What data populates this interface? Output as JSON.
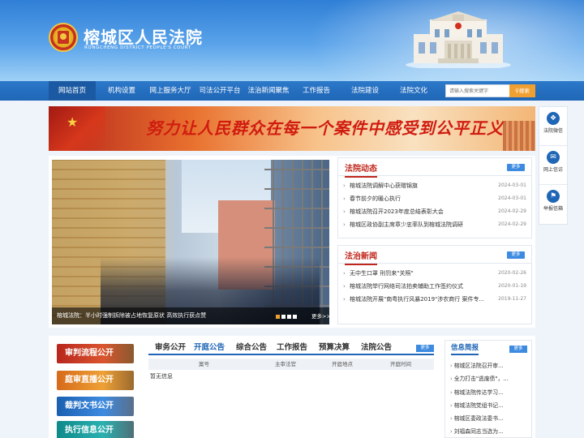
{
  "header": {
    "title": "榕城区人民法院",
    "subtitle": "RONGCHENG DISTRICT PEOPLE'S COURT"
  },
  "nav": {
    "items": [
      "网站首页",
      "机构设置",
      "网上服务大厅",
      "司法公开平台",
      "法治新闻聚焦",
      "工作报告",
      "法院建设",
      "法院文化"
    ],
    "search_placeholder": "请输入搜索关键字",
    "search_button": "搜索"
  },
  "banner": {
    "slogan": "努力让人民群众在每一个案件中感受到公平正义"
  },
  "side_tools": [
    {
      "label": "法院微信",
      "icon": "chat-icon"
    },
    {
      "label": "网上信访",
      "icon": "petition-icon"
    },
    {
      "label": "举报信箱",
      "icon": "report-icon"
    }
  ],
  "slideshow": {
    "caption": "榕城法院：半小时强制拆除被占地恢复原状 高效执行获点赞",
    "more": "更多>>",
    "dots": 4,
    "active_dot": 0
  },
  "court_news": {
    "title": "法院动态",
    "more": "更多",
    "items": [
      {
        "text": "榕城法院调解中心获赠锦旗",
        "date": "2024-03-01"
      },
      {
        "text": "春节前夕的暖心执行",
        "date": "2024-03-01"
      },
      {
        "text": "榕城法院召开2023年度总结表彰大会",
        "date": "2024-02-29"
      },
      {
        "text": "榕城区政协副主席章少忠率队到榕城法院调研",
        "date": "2024-02-29"
      }
    ]
  },
  "law_news": {
    "title": "法治新闻",
    "more": "更多",
    "items": [
      {
        "text": "无中生口罩 刑罚来\"关照\"",
        "date": "2020-02-26"
      },
      {
        "text": "榕城法院举行网络司法拍卖辅助工作签约仪式",
        "date": "2020-01-19"
      },
      {
        "text": "榕城法院开展\"南粤执行风暴2019\"涉农商行 案件专...",
        "date": "2019-11-27"
      }
    ]
  },
  "pillars": [
    "审判流程公开",
    "庭审直播公开",
    "裁判文书公开",
    "执行信息公开"
  ],
  "disclosure": {
    "tabs": [
      "审务公开",
      "开庭公告",
      "综合公告",
      "工作报告",
      "预算决算",
      "法院公告"
    ],
    "active_tab": 1,
    "more": "更多",
    "columns": [
      "案号",
      "主审法官",
      "开庭地点",
      "开庭时间"
    ],
    "empty_text": "暂无信息"
  },
  "info_brief": {
    "title": "信息简报",
    "more": "更多",
    "items": [
      "榕城区法院召开审...",
      "全力打击\"逃废债\"，...",
      "榕城法院传达学习...",
      "榕城法院党组书记...",
      "榕城区委政法委书...",
      "刘福森同志当选为..."
    ]
  },
  "colors": {
    "primary_blue": "#1f66b6",
    "accent_red": "#c0261c",
    "accent_orange": "#f0a030"
  }
}
